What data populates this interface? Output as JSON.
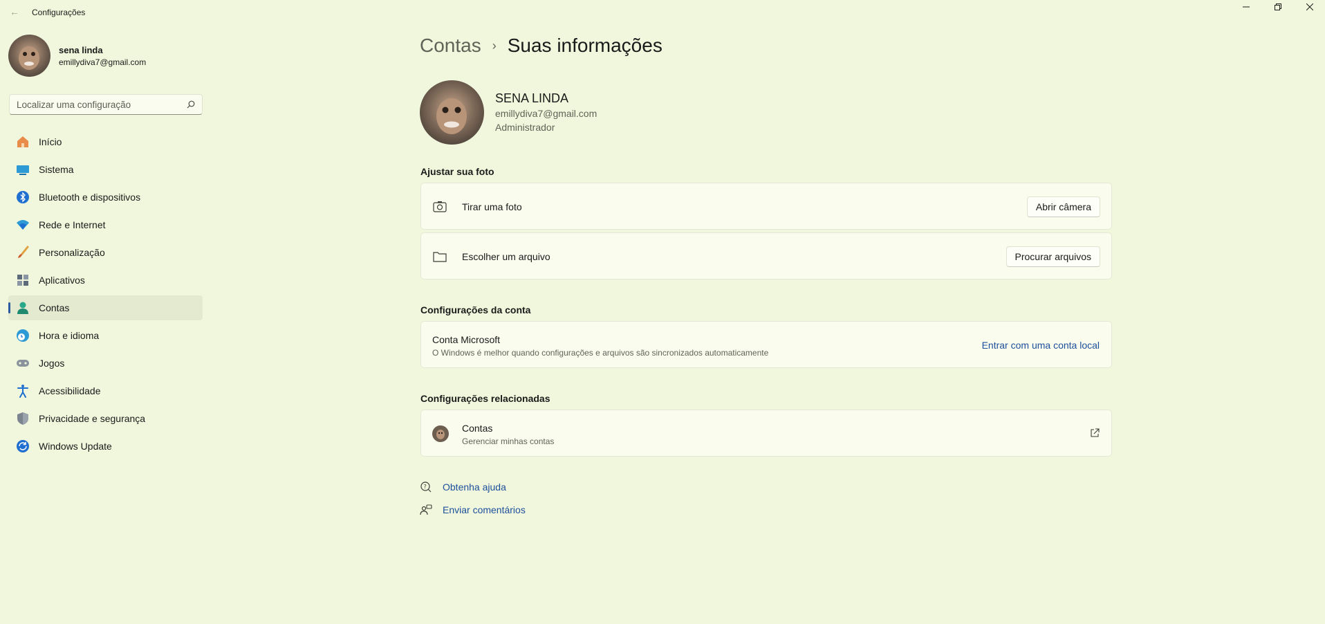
{
  "window": {
    "title": "Configurações"
  },
  "profile": {
    "name": "sena linda",
    "email": "emillydiva7@gmail.com"
  },
  "search": {
    "placeholder": "Localizar uma configuração"
  },
  "nav": {
    "items": [
      {
        "label": "Início",
        "icon": "home-icon"
      },
      {
        "label": "Sistema",
        "icon": "system-icon"
      },
      {
        "label": "Bluetooth e dispositivos",
        "icon": "bluetooth-icon"
      },
      {
        "label": "Rede e Internet",
        "icon": "wifi-icon"
      },
      {
        "label": "Personalização",
        "icon": "brush-icon"
      },
      {
        "label": "Aplicativos",
        "icon": "apps-icon"
      },
      {
        "label": "Contas",
        "icon": "person-icon",
        "active": true
      },
      {
        "label": "Hora e idioma",
        "icon": "globe-clock-icon"
      },
      {
        "label": "Jogos",
        "icon": "gamepad-icon"
      },
      {
        "label": "Acessibilidade",
        "icon": "accessibility-icon"
      },
      {
        "label": "Privacidade e segurança",
        "icon": "shield-icon"
      },
      {
        "label": "Windows Update",
        "icon": "update-icon"
      }
    ]
  },
  "breadcrumb": {
    "parent": "Contas",
    "separator": "›",
    "current": "Suas informações"
  },
  "user": {
    "name": "SENA LINDA",
    "email": "emillydiva7@gmail.com",
    "role": "Administrador"
  },
  "photo_section": {
    "title": "Ajustar sua foto",
    "take_photo": {
      "label": "Tirar uma foto",
      "button": "Abrir câmera"
    },
    "choose_file": {
      "label": "Escolher um arquivo",
      "button": "Procurar arquivos"
    }
  },
  "account_section": {
    "title": "Configurações da conta",
    "microsoft": {
      "title": "Conta Microsoft",
      "subtitle": "O Windows é melhor quando configurações e arquivos são sincronizados automaticamente",
      "link": "Entrar com uma conta local"
    }
  },
  "related_section": {
    "title": "Configurações relacionadas",
    "accounts": {
      "title": "Contas",
      "subtitle": "Gerenciar minhas contas"
    }
  },
  "help": {
    "get_help": "Obtenha ajuda",
    "feedback": "Enviar comentários"
  },
  "colors": {
    "background": "#f1f7dc",
    "accent": "#2b5aa0",
    "link": "#1c4f9c"
  }
}
